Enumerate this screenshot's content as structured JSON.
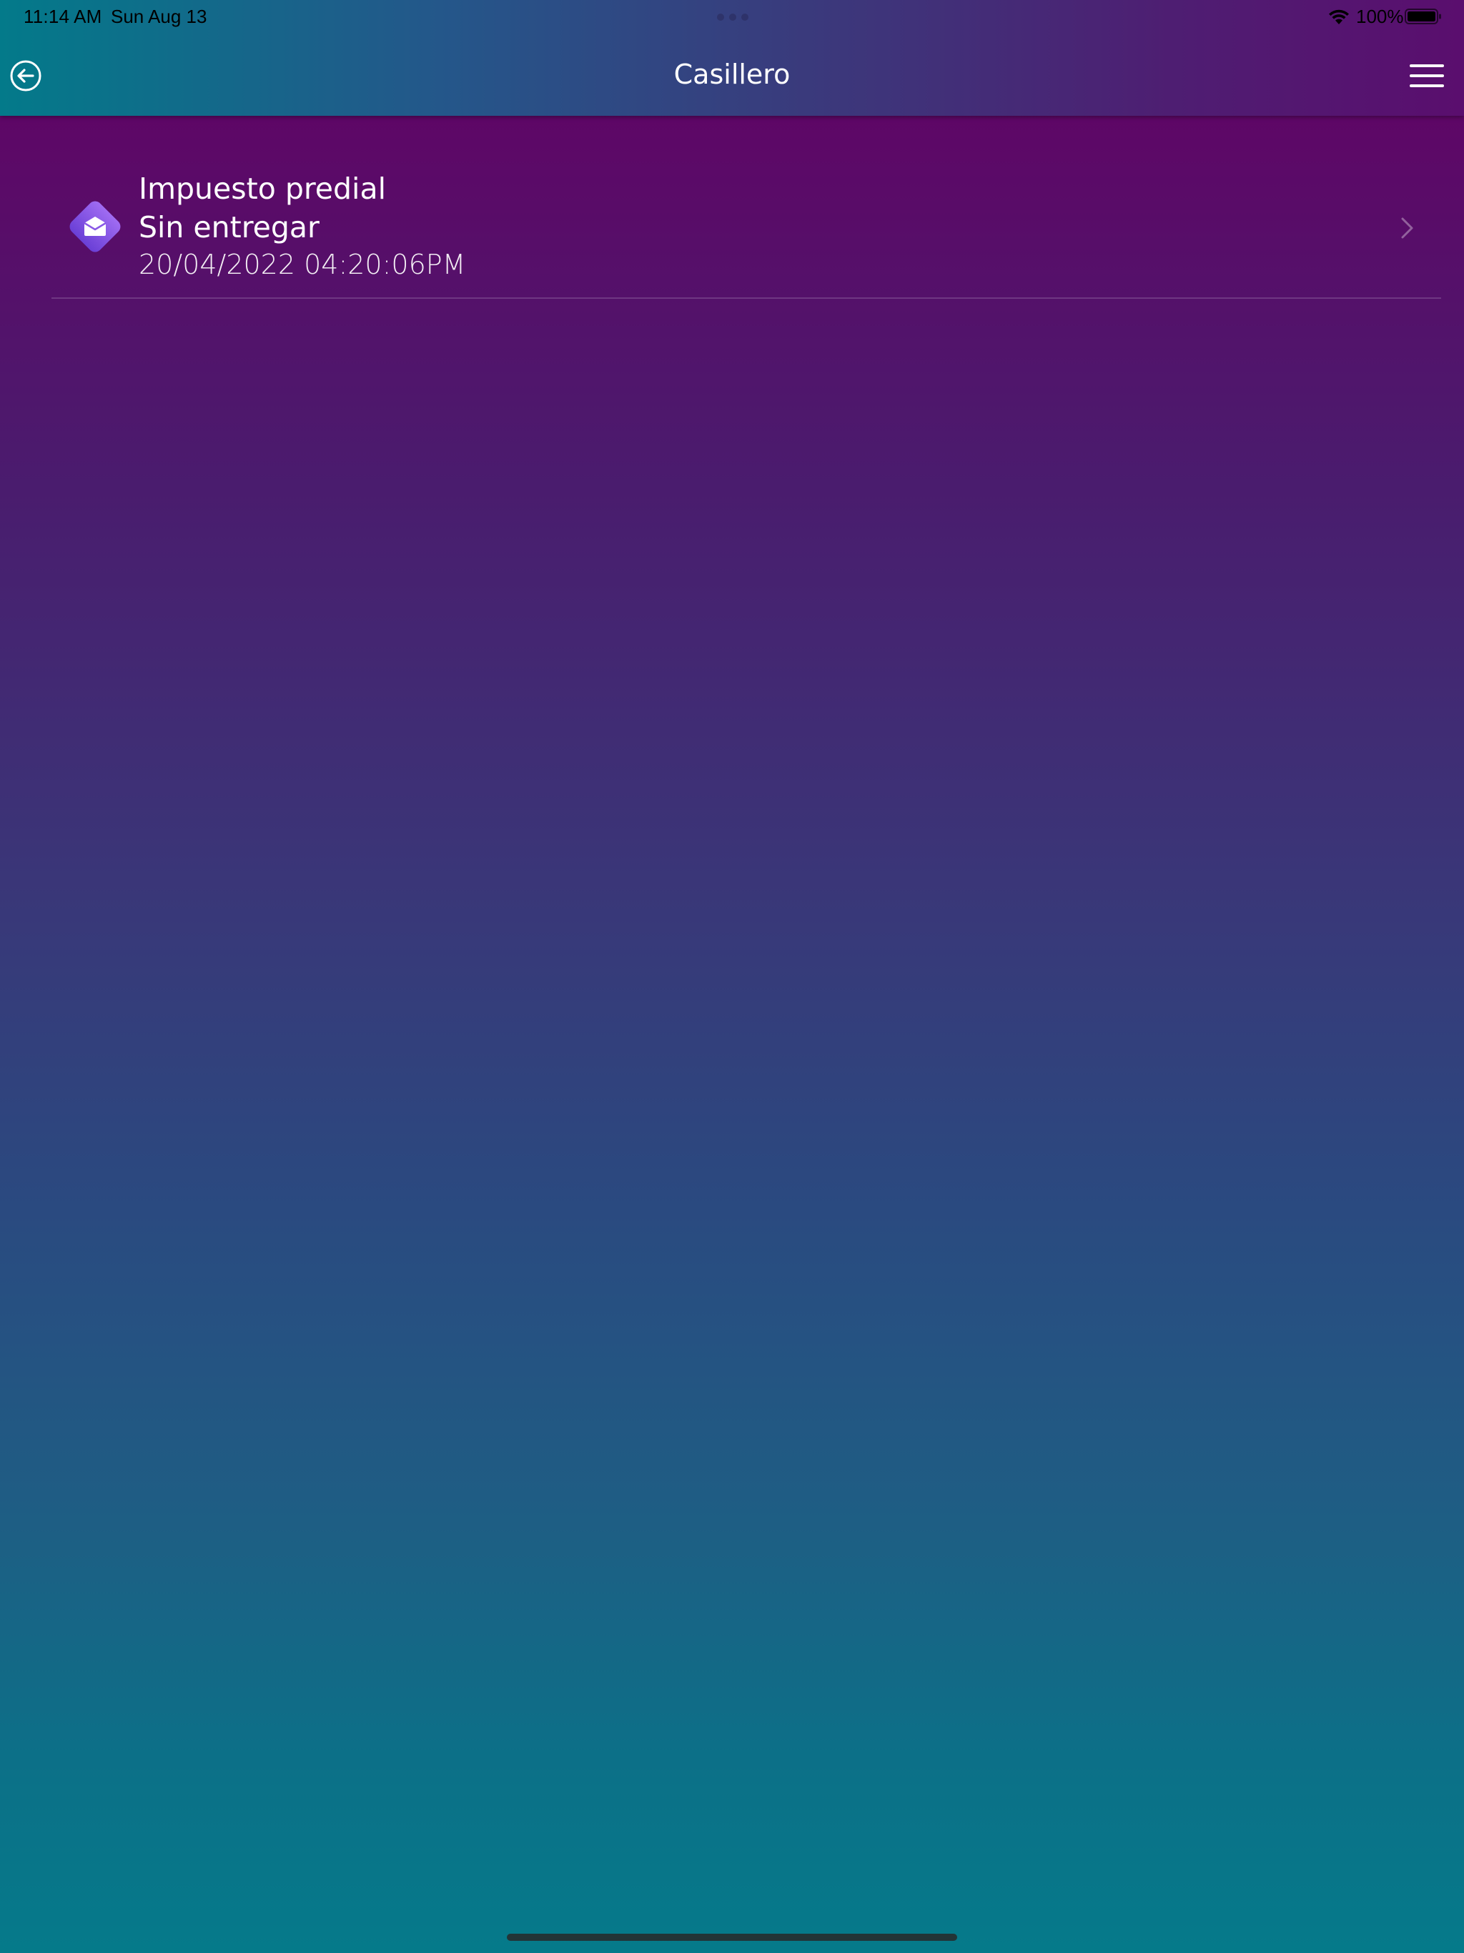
{
  "status_bar": {
    "time": "11:14 AM",
    "date": "Sun Aug 13",
    "battery_percent": "100%",
    "battery_level": 1.0
  },
  "nav": {
    "title": "Casillero",
    "back_icon": "back-arrow-circle-icon",
    "menu_icon": "hamburger-menu-icon"
  },
  "items": [
    {
      "title": "Impuesto predial",
      "status": "Sin entregar",
      "datetime": "20/04/2022 04:20:06PM",
      "icon": "open-envelope-icon"
    }
  ],
  "colors": {
    "icon_diamond_top": "#9a66f0",
    "icon_diamond_bottom": "#6a3fd6"
  }
}
